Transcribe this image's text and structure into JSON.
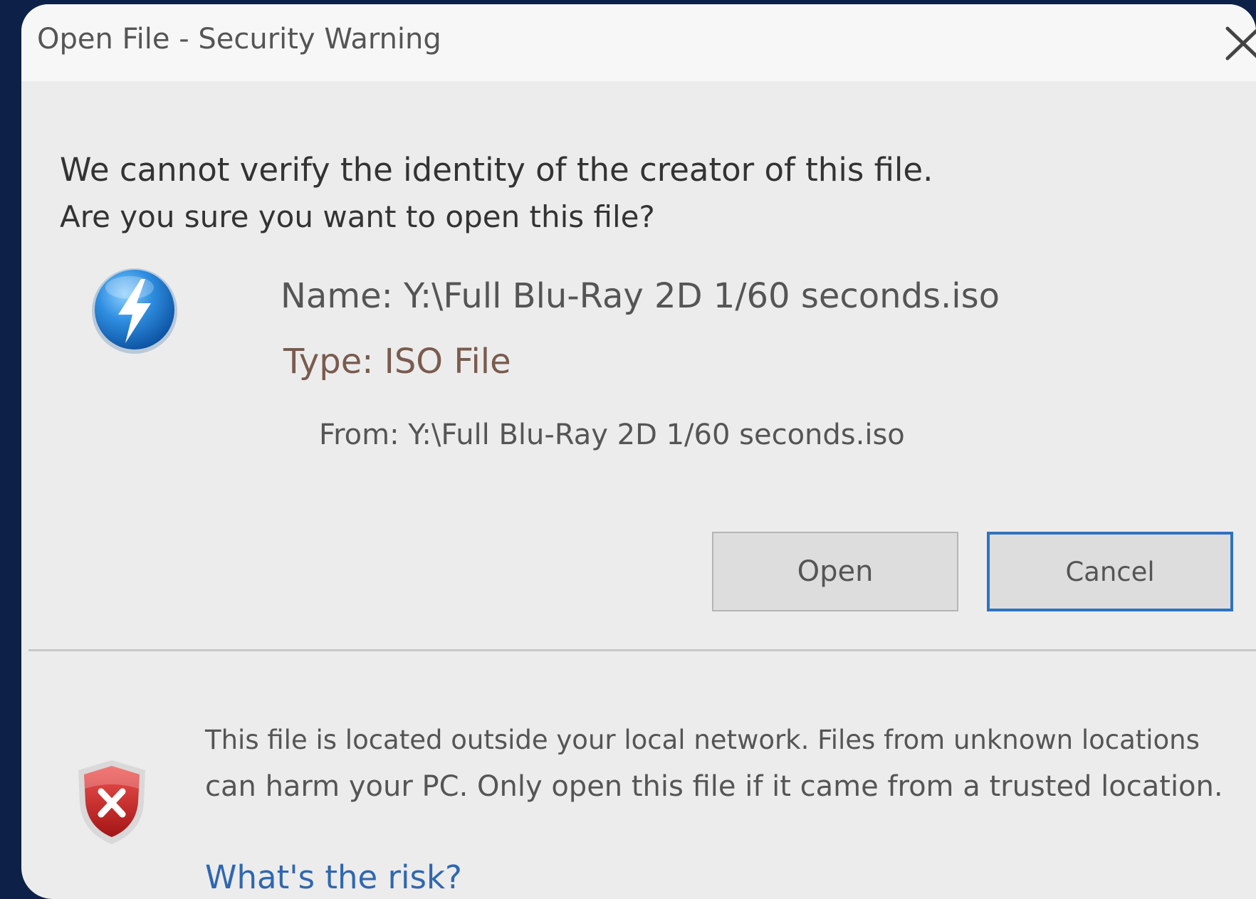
{
  "dialog": {
    "title": "Open File - Security Warning",
    "close_icon": "close-icon"
  },
  "warning": {
    "line1": "We cannot verify the identity of the creator of this file.",
    "line2": "Are you sure you want to open this file?"
  },
  "file": {
    "app_icon": "lightning-bolt-icon",
    "name": "Name: Y:\\Full Blu-Ray 2D 1/60 seconds.iso",
    "type": "Type: ISO File",
    "from": "From: Y:\\Full Blu-Ray 2D 1/60 seconds.iso"
  },
  "buttons": {
    "open_label": "Open",
    "cancel_label": "Cancel"
  },
  "security_info": {
    "shield_icon": "shield-error-icon",
    "line1": "This file is located outside your local network. Files from unknown locations",
    "line2": "can harm your PC. Only open this file if it came from a trusted location.",
    "link": "What's the risk?"
  },
  "colors": {
    "backdrop": "#0d2148",
    "dialog_bg": "#ececec",
    "titlebar_bg": "#f7f7f7",
    "accent_blue": "#2e72c2",
    "link_blue": "#2f67b0",
    "type_text": "#7a5b4e",
    "shield_red": "#c62828"
  }
}
